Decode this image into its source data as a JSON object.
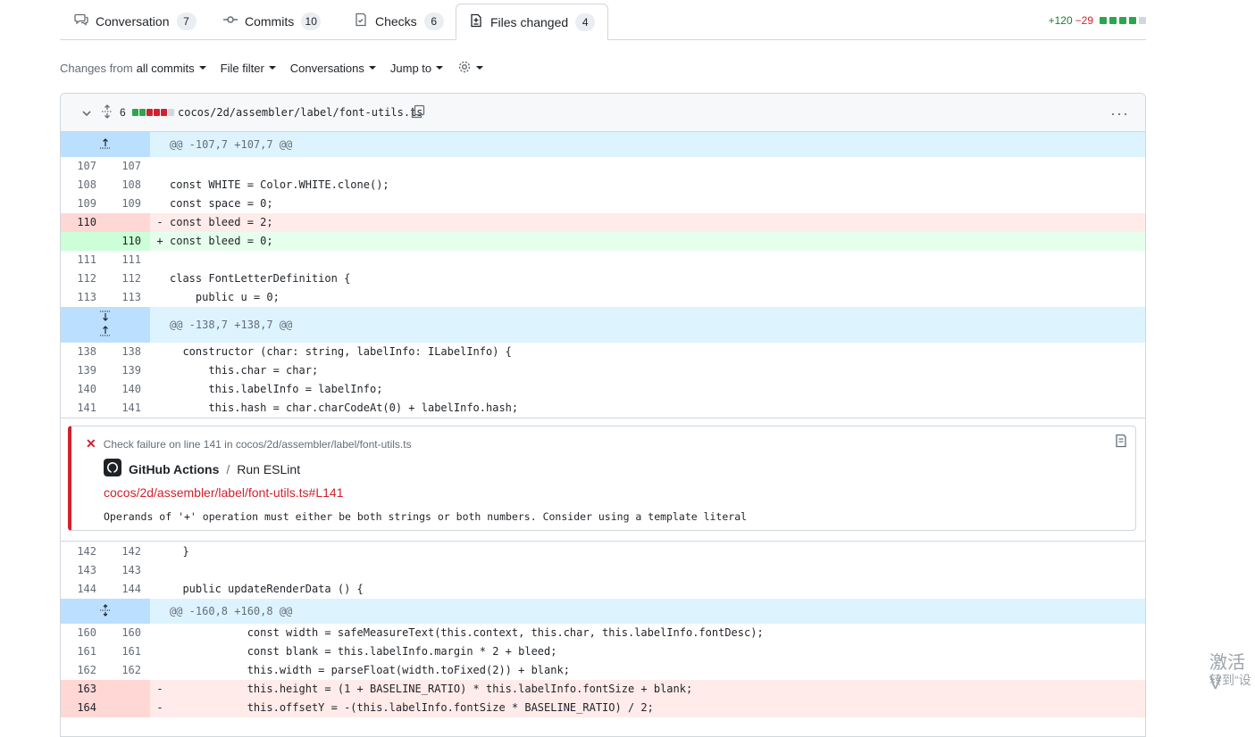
{
  "tabs": [
    {
      "label": "Conversation",
      "count": "7",
      "icon": "conversation-icon"
    },
    {
      "label": "Commits",
      "count": "10",
      "icon": "commit-icon"
    },
    {
      "label": "Checks",
      "count": "6",
      "icon": "checks-icon"
    },
    {
      "label": "Files changed",
      "count": "4",
      "icon": "file-diff-icon"
    }
  ],
  "diffstat": {
    "additions": "+120",
    "deletions": "−29"
  },
  "toolbar": {
    "changes_prefix": "Changes from",
    "changes_value": "all commits",
    "file_filter": "File filter",
    "conversations": "Conversations",
    "jump_to": "Jump to"
  },
  "file": {
    "changes": "6",
    "path": "cocos/2d/assembler/label/font-utils.ts"
  },
  "hunks": {
    "h1": "@@ -107,7 +107,7 @@",
    "h2": "@@ -138,7 +138,7 @@",
    "h3": "@@ -160,8 +160,8 @@"
  },
  "lines": [
    {
      "o": "107",
      "n": "107",
      "s": "",
      "t": ""
    },
    {
      "o": "108",
      "n": "108",
      "s": "",
      "t": "const WHITE = Color.WHITE.clone();"
    },
    {
      "o": "109",
      "n": "109",
      "s": "",
      "t": "const space = 0;"
    },
    {
      "o": "110",
      "n": "",
      "s": "-",
      "t": "const bleed = 2;"
    },
    {
      "o": "",
      "n": "110",
      "s": "+",
      "t": "const bleed = 0;"
    },
    {
      "o": "111",
      "n": "111",
      "s": "",
      "t": ""
    },
    {
      "o": "112",
      "n": "112",
      "s": "",
      "t": "class FontLetterDefinition {"
    },
    {
      "o": "113",
      "n": "113",
      "s": "",
      "t": "    public u = 0;"
    },
    {
      "o": "138",
      "n": "138",
      "s": "",
      "t": "  constructor (char: string, labelInfo: ILabelInfo) {"
    },
    {
      "o": "139",
      "n": "139",
      "s": "",
      "t": "      this.char = char;"
    },
    {
      "o": "140",
      "n": "140",
      "s": "",
      "t": "      this.labelInfo = labelInfo;"
    },
    {
      "o": "141",
      "n": "141",
      "s": "",
      "t": "      this.hash = char.charCodeAt(0) + labelInfo.hash;"
    },
    {
      "o": "142",
      "n": "142",
      "s": "",
      "t": "  }"
    },
    {
      "o": "143",
      "n": "143",
      "s": "",
      "t": ""
    },
    {
      "o": "144",
      "n": "144",
      "s": "",
      "t": "  public updateRenderData () {"
    },
    {
      "o": "160",
      "n": "160",
      "s": "",
      "t": "            const width = safeMeasureText(this.context, this.char, this.labelInfo.fontDesc);"
    },
    {
      "o": "161",
      "n": "161",
      "s": "",
      "t": "            const blank = this.labelInfo.margin * 2 + bleed;"
    },
    {
      "o": "162",
      "n": "162",
      "s": "",
      "t": "            this.width = parseFloat(width.toFixed(2)) + blank;"
    },
    {
      "o": "163",
      "n": "",
      "s": "-",
      "t": "            this.height = (1 + BASELINE_RATIO) * this.labelInfo.fontSize + blank;"
    },
    {
      "o": "164",
      "n": "",
      "s": "-",
      "t": "            this.offsetY = -(this.labelInfo.fontSize * BASELINE_RATIO) / 2;"
    }
  ],
  "annotation": {
    "title": "Check failure on line 141 in cocos/2d/assembler/label/font-utils.ts",
    "app": "GitHub Actions",
    "separator": "/",
    "job": "Run ESLint",
    "link": "cocos/2d/assembler/label/font-utils.ts#L141",
    "message": "Operands of '+' operation must either be both strings or both numbers. Consider using a template literal"
  },
  "watermark": {
    "line1": "激活 V",
    "line2": "转到“设"
  }
}
